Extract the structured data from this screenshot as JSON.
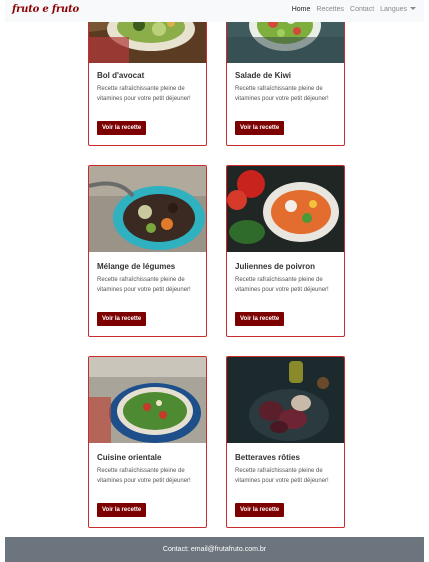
{
  "navbar": {
    "brand": "fruto e fruto",
    "links": [
      "Home",
      "Recettes",
      "Contact"
    ],
    "dropdown_label": "Langues"
  },
  "cards": [
    {
      "title": "Bol d'avocat",
      "text": "Recette rafraîchissante pleine de vitamines pour votre petit déjeuner!",
      "button": "Voir la recette"
    },
    {
      "title": "Salade de Kiwi",
      "text": "Recette rafraîchissante pleine de vitamines pour votre petit déjeuner!",
      "button": "Voir la recette"
    },
    {
      "title": "Mélange de légumes",
      "text": "Recette rafraîchissante pleine de vitamines pour votre petit déjeuner!",
      "button": "Voir la recette"
    },
    {
      "title": "Juliennes de poivron",
      "text": "Recette rafraîchissante pleine de vitamines pour votre petit déjeuner!",
      "button": "Voir la recette"
    },
    {
      "title": "Cuisine orientale",
      "text": "Recette rafraîchissante pleine de vitamines pour votre petit déjeuner!",
      "button": "Voir la recette"
    },
    {
      "title": "Betteraves rôties",
      "text": "Recette rafraîchissante pleine de vitamines pour votre petit déjeuner!",
      "button": "Voir la recette"
    }
  ],
  "footer": {
    "text": "Contact: email@frutafruto.com.br"
  },
  "colors": {
    "accent": "#7c0000",
    "card_border": "#c82c2c",
    "footer_bg": "#6c757d",
    "navbar_bg": "#f8f9fa"
  }
}
